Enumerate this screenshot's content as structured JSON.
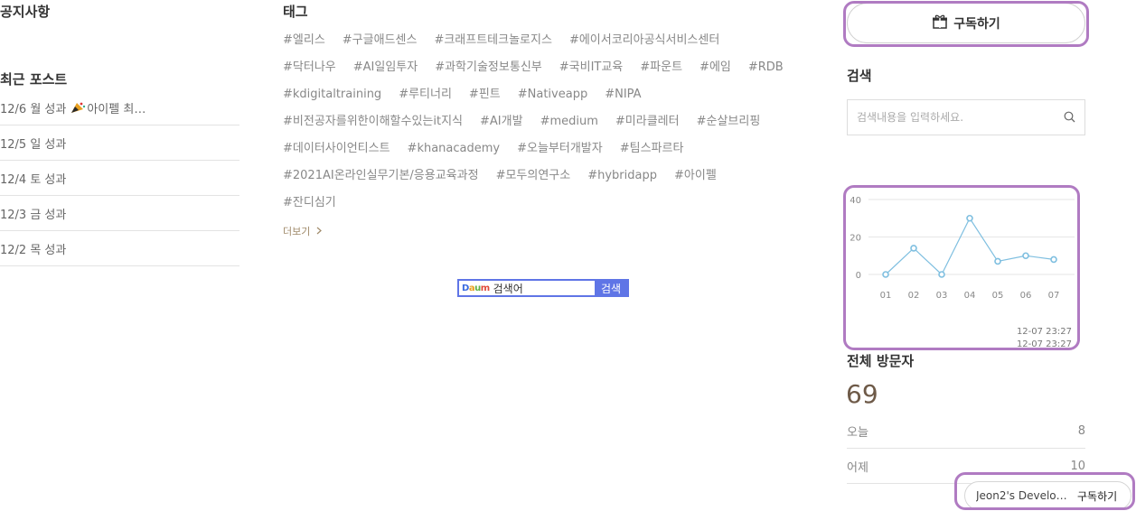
{
  "notice": {
    "title": "공지사항"
  },
  "recent": {
    "title": "최근 포스트",
    "items": [
      {
        "label": "12/6 월 성과",
        "suffix": "아이펠 최…"
      },
      {
        "label": "12/5 일 성과",
        "suffix": ""
      },
      {
        "label": "12/4 토 성과",
        "suffix": ""
      },
      {
        "label": "12/3 금 성과",
        "suffix": ""
      },
      {
        "label": "12/2 목 성과",
        "suffix": ""
      }
    ]
  },
  "tags": {
    "title": "태그",
    "items": [
      "#엘리스",
      "#구글애드센스",
      "#크래프트테크놀로지스",
      "#에이서코리아공식서비스센터",
      "#닥터나우",
      "#AI일임투자",
      "#과학기술정보통신부",
      "#국비IT교육",
      "#파운트",
      "#에임",
      "#RDB",
      "#kdigitaltraining",
      "#루티너리",
      "#핀트",
      "#Nativeapp",
      "#NIPA",
      "#비전공자를위한이해할수있는it지식",
      "#AI개발",
      "#medium",
      "#미라클레터",
      "#순살브리핑",
      "#데이터사이언티스트",
      "#khanacademy",
      "#오늘부터개발자",
      "#팀스파르타",
      "#2021AI온라인실무기본/응용교육과정",
      "#모두의연구소",
      "#hybridapp",
      "#아이펠",
      "#잔디심기"
    ],
    "more": "더보기"
  },
  "daum": {
    "logo": "Daum",
    "input": "검색어",
    "button": "검색"
  },
  "subscribe": {
    "label": "구독하기"
  },
  "search": {
    "title": "검색",
    "placeholder": "검색내용을 입력하세요."
  },
  "chart_data": {
    "type": "line",
    "categories": [
      "01",
      "02",
      "03",
      "04",
      "05",
      "06",
      "07"
    ],
    "series": [
      {
        "values": [
          0,
          14,
          0,
          30,
          7,
          10,
          8
        ]
      }
    ],
    "ylim": [
      0,
      40
    ],
    "yticks": [
      0,
      20,
      40
    ],
    "grid": true,
    "color": "#7fbfe0",
    "timestamps": [
      "12-07 23:27",
      "12-07 23:27"
    ]
  },
  "visitors": {
    "title": "전체 방문자",
    "total": "69",
    "today_label": "오늘",
    "today": "8",
    "yesterday_label": "어제",
    "yesterday": "10"
  },
  "floating": {
    "blog": "Jeon2's Develo…",
    "action": "구독하기"
  }
}
